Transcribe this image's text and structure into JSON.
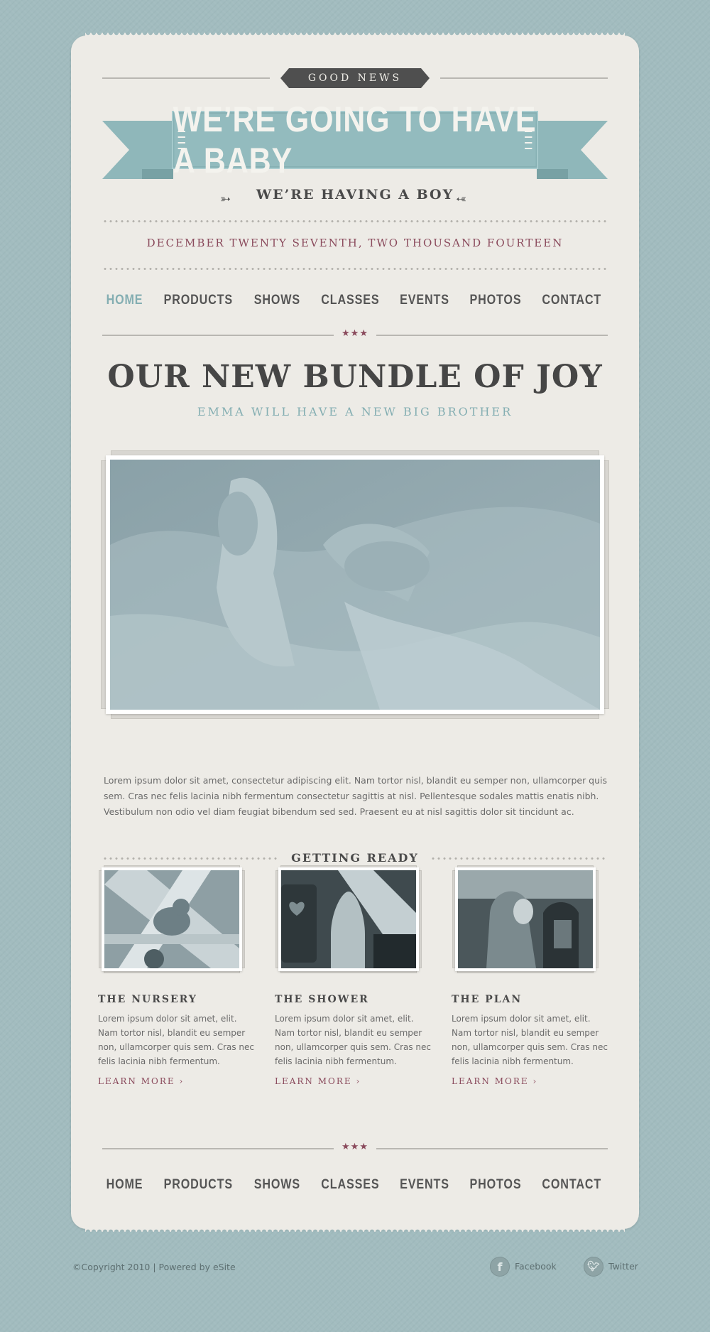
{
  "header": {
    "badge": "GOOD NEWS",
    "banner": "WE’RE GOING TO HAVE A BABY",
    "tagline": "WE’RE HAVING A BOY",
    "date": "DECEMBER TWENTY SEVENTH, TWO THOUSAND FOURTEEN"
  },
  "nav": {
    "items": [
      "HOME",
      "PRODUCTS",
      "SHOWS",
      "CLASSES",
      "EVENTS",
      "PHOTOS",
      "CONTACT"
    ],
    "active": "HOME"
  },
  "ornament": "★★★",
  "hero": {
    "title": "OUR NEW BUNDLE OF JOY",
    "subtitle": "EMMA WILL HAVE A NEW BIG BROTHER",
    "paragraph": "Lorem ipsum dolor sit amet, consectetur adipiscing elit. Nam tortor nisl, blandit eu semper non, ullamcorper quis sem. Cras nec felis lacinia nibh fermentum consectetur sagittis at nisl. Pellentesque sodales mattis enatis nibh. Vestibulum non odio vel diam feugiat bibendum sed sed. Praesent eu at nisl sagittis dolor sit tincidunt ac."
  },
  "section": {
    "title": "GETTING READY",
    "columns": [
      {
        "title": "THE NURSERY",
        "text": "Lorem ipsum dolor sit amet, elit. Nam tortor nisl, blandit eu semper non, ullamcorper quis sem. Cras nec felis lacinia nibh fermentum.",
        "link": "LEARN MORE ›"
      },
      {
        "title": "THE SHOWER",
        "text": "Lorem ipsum dolor sit amet, elit. Nam tortor nisl, blandit eu semper non, ullamcorper quis sem. Cras nec felis lacinia nibh fermentum.",
        "link": "LEARN MORE ›"
      },
      {
        "title": "THE PLAN",
        "text": "Lorem ipsum dolor sit amet, elit. Nam tortor nisl, blandit eu semper non, ullamcorper quis sem. Cras nec felis lacinia nibh fermentum.",
        "link": "LEARN MORE ›"
      }
    ]
  },
  "footer": {
    "copyright": "©Copyright 2010 | Powered by eSite",
    "social": [
      {
        "label": "Facebook",
        "icon": "facebook-icon"
      },
      {
        "label": "Twitter",
        "icon": "twitter-icon"
      }
    ]
  },
  "colors": {
    "background": "#a2bcbf",
    "card": "#edebe6",
    "accent_teal": "#84aeb2",
    "accent_wine": "#8a4a5c",
    "text_dark": "#4a4a4a"
  }
}
